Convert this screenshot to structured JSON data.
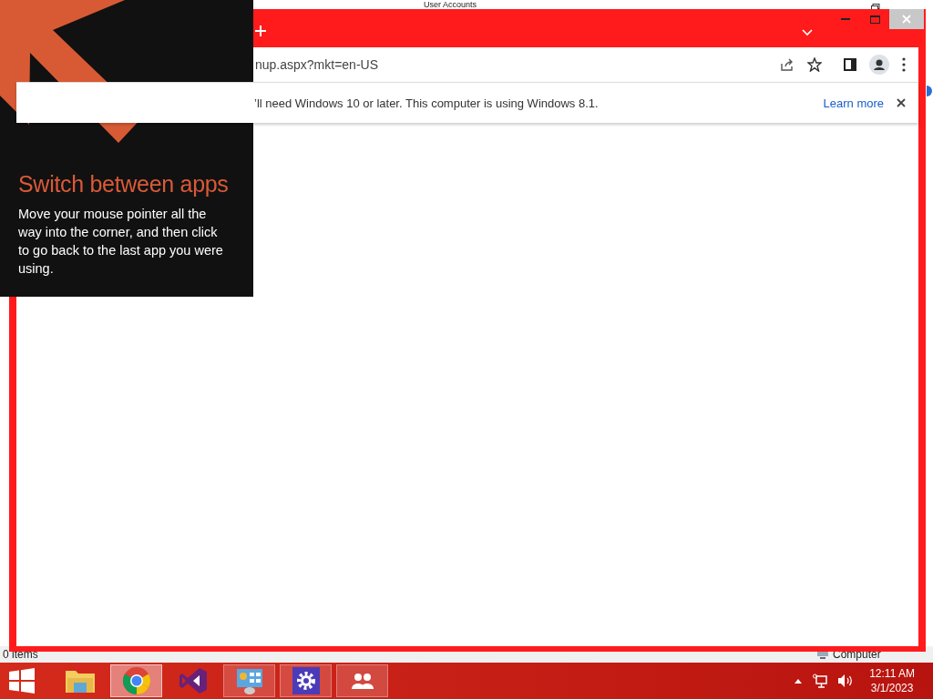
{
  "background_window": {
    "title": "User Accounts",
    "status_text": "0 items",
    "location": "Computer"
  },
  "browser": {
    "address": "nup.aspx?mkt=en-US",
    "infobar": {
      "message": "’ll need Windows 10 or later. This computer is using Windows 8.1.",
      "link": "Learn more"
    }
  },
  "tip": {
    "title": "Switch between apps",
    "body": "Move your mouse pointer all the way into the corner, and then click to go back to the last app you were using."
  },
  "taskbar": {
    "apps": [
      {
        "kind": "explorer",
        "running": false,
        "selected": false
      },
      {
        "kind": "chrome",
        "running": true,
        "selected": true
      },
      {
        "kind": "visual-studio",
        "running": false,
        "selected": false
      },
      {
        "kind": "control-panel",
        "running": true,
        "selected": false
      },
      {
        "kind": "settings",
        "running": true,
        "selected": false
      },
      {
        "kind": "people",
        "running": true,
        "selected": false
      }
    ],
    "clock": {
      "time": "12:11 AM",
      "date": "3/1/2023"
    }
  }
}
